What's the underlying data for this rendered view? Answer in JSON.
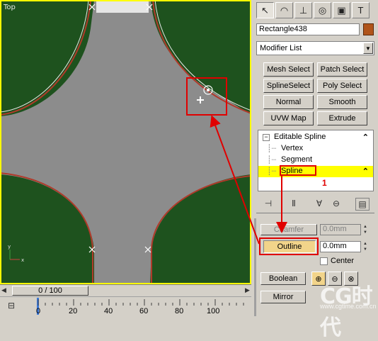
{
  "viewport": {
    "label": "Top",
    "frame_color": "#ffff00",
    "road_color": "#8c8c8c",
    "grass_color": "#1e521e"
  },
  "panel": {
    "tabs": [
      {
        "icon": "create-icon",
        "glyph": "↖"
      },
      {
        "icon": "modify-icon",
        "glyph": "◠"
      },
      {
        "icon": "hierarchy-icon",
        "glyph": "⊥"
      },
      {
        "icon": "motion-icon",
        "glyph": "◎"
      },
      {
        "icon": "display-icon",
        "glyph": "▣"
      },
      {
        "icon": "utilities-icon",
        "glyph": "T"
      }
    ],
    "object_name": "Rectangle438",
    "object_color": "#b0541a",
    "modifier_list": "Modifier List",
    "modifier_buttons": [
      "Mesh Select",
      "Patch Select",
      "SplineSelect",
      "Poly Select",
      "Normal",
      "Smooth",
      "UVW Map",
      "Extrude"
    ],
    "stack": {
      "root": "Editable Spline",
      "children": [
        "Vertex",
        "Segment",
        "Spline"
      ],
      "selected": "Spline"
    },
    "callout_number": "1",
    "chamfer_label": "Chamfer",
    "chamfer_value": "0.0mm",
    "outline_label": "Outline",
    "outline_value": "0.0mm",
    "center_label": "Center",
    "boolean_label": "Boolean",
    "mirror_label": "Mirror"
  },
  "timeline": {
    "slider_label": "0 / 100",
    "ticks": [
      "0",
      "20",
      "40",
      "60",
      "80",
      "100"
    ]
  },
  "watermark": {
    "text": "CG时代",
    "url": "www.cgtime.com.cn"
  },
  "annotation_color": "#e00000"
}
